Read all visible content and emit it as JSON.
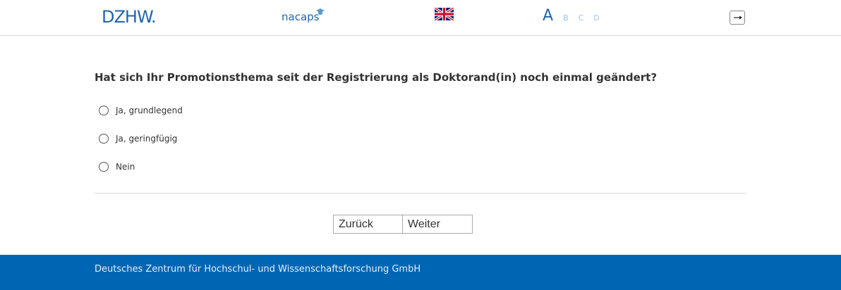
{
  "header": {
    "dzhw_logo": "DZHW.",
    "nacaps_logo": "nacaps",
    "language_icon": "uk-flag-icon",
    "font_sizes": [
      "A",
      "B",
      "C",
      "D"
    ],
    "logout_icon": "logout-icon"
  },
  "question": {
    "text": "Hat sich Ihr Promotionsthema seit der Registrierung als Doktorand(in) noch einmal geändert?",
    "options": [
      "Ja, grundlegend",
      "Ja, geringfügig",
      "Nein"
    ]
  },
  "navigation": {
    "back_label": "Zurück",
    "next_label": "Weiter"
  },
  "footer": {
    "text": "Deutsches Zentrum für Hochschul- und Wissenschaftsforschung GmbH"
  },
  "colors": {
    "brand_blue": "#1f66ae",
    "footer_blue": "#0066b3"
  }
}
